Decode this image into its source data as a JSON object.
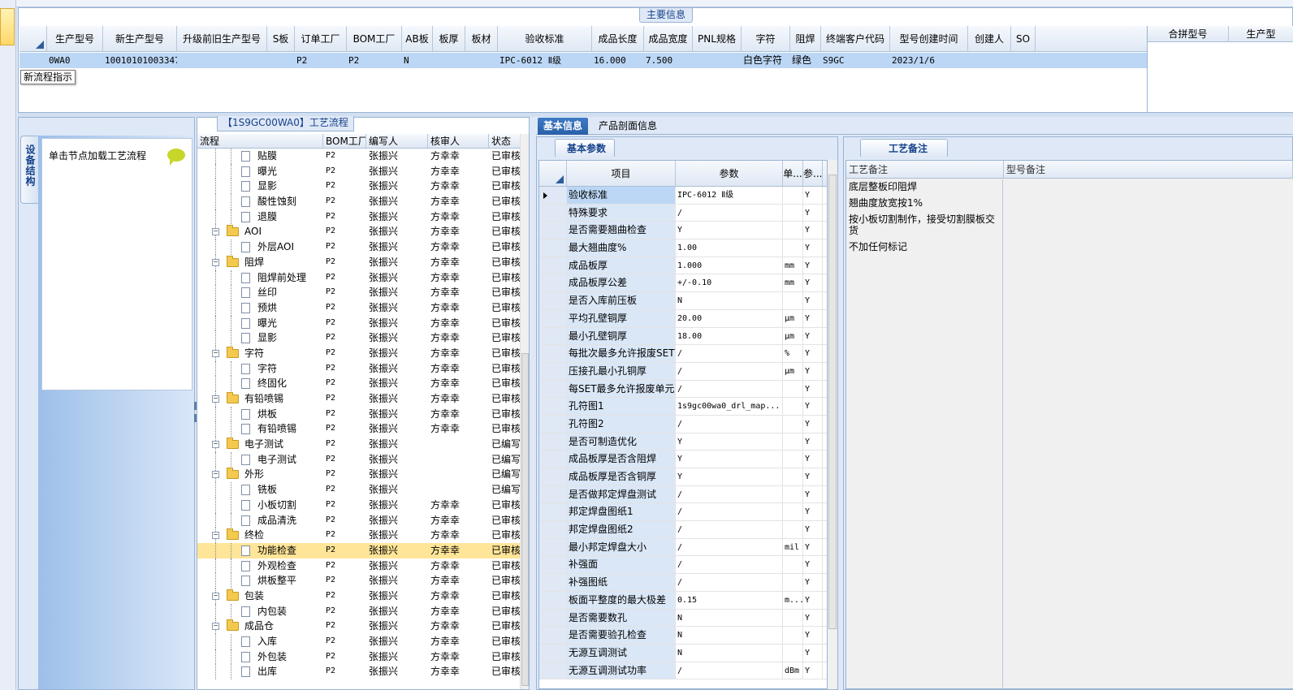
{
  "main_info": {
    "title": "主要信息",
    "columns": [
      "生产型号",
      "新生产型号",
      "升级前旧生产型号",
      "S板",
      "订单工厂",
      "BOM工厂",
      "AB板",
      "板厚",
      "板材",
      "验收标准",
      "成品长度",
      "成品宽度",
      "PNL规格",
      "字符",
      "阻焊",
      "终端客户代码",
      "型号创建时间",
      "创建人",
      "SO"
    ],
    "row": [
      "0WA0",
      "10010101003347",
      "",
      "",
      "P2",
      "P2",
      "N",
      "",
      "",
      "IPC-6012 Ⅱ级",
      "16.000",
      "7.500",
      "",
      "白色字符",
      "绿色",
      "S9GC",
      "2023/1/6",
      "",
      ""
    ],
    "tooltip": "新流程指示",
    "merge_columns": [
      "合拼型号",
      "生产型"
    ]
  },
  "device_panel": {
    "tab_label": "设备结构",
    "item_label": "单击节点加载工艺流程"
  },
  "process_panel": {
    "title": "【1S9GC00WA0】工艺流程",
    "columns": [
      "流程",
      "BOM工厂",
      "编写人",
      "核审人",
      "状态"
    ],
    "rows": [
      {
        "name": "贴膜",
        "level": 2,
        "type": "doc",
        "bom": "P2",
        "writer": "张振兴",
        "reviewer": "方幸幸",
        "status": "已审核"
      },
      {
        "name": "曝光",
        "level": 2,
        "type": "doc",
        "bom": "P2",
        "writer": "张振兴",
        "reviewer": "方幸幸",
        "status": "已审核"
      },
      {
        "name": "显影",
        "level": 2,
        "type": "doc",
        "bom": "P2",
        "writer": "张振兴",
        "reviewer": "方幸幸",
        "status": "已审核"
      },
      {
        "name": "酸性蚀刻",
        "level": 2,
        "type": "doc",
        "bom": "P2",
        "writer": "张振兴",
        "reviewer": "方幸幸",
        "status": "已审核"
      },
      {
        "name": "退膜",
        "level": 2,
        "type": "doc",
        "bom": "P2",
        "writer": "张振兴",
        "reviewer": "方幸幸",
        "status": "已审核"
      },
      {
        "name": "AOI",
        "level": 1,
        "type": "folder",
        "bom": "P2",
        "writer": "张振兴",
        "reviewer": "方幸幸",
        "status": "已审核"
      },
      {
        "name": "外层AOI",
        "level": 2,
        "type": "doc",
        "bom": "P2",
        "writer": "张振兴",
        "reviewer": "方幸幸",
        "status": "已审核"
      },
      {
        "name": "阻焊",
        "level": 1,
        "type": "folder",
        "bom": "P2",
        "writer": "张振兴",
        "reviewer": "方幸幸",
        "status": "已审核"
      },
      {
        "name": "阻焊前处理",
        "level": 2,
        "type": "doc",
        "bom": "P2",
        "writer": "张振兴",
        "reviewer": "方幸幸",
        "status": "已审核"
      },
      {
        "name": "丝印",
        "level": 2,
        "type": "doc",
        "bom": "P2",
        "writer": "张振兴",
        "reviewer": "方幸幸",
        "status": "已审核"
      },
      {
        "name": "预烘",
        "level": 2,
        "type": "doc",
        "bom": "P2",
        "writer": "张振兴",
        "reviewer": "方幸幸",
        "status": "已审核"
      },
      {
        "name": "曝光",
        "level": 2,
        "type": "doc",
        "bom": "P2",
        "writer": "张振兴",
        "reviewer": "方幸幸",
        "status": "已审核"
      },
      {
        "name": "显影",
        "level": 2,
        "type": "doc",
        "bom": "P2",
        "writer": "张振兴",
        "reviewer": "方幸幸",
        "status": "已审核"
      },
      {
        "name": "字符",
        "level": 1,
        "type": "folder",
        "bom": "P2",
        "writer": "张振兴",
        "reviewer": "方幸幸",
        "status": "已审核"
      },
      {
        "name": "字符",
        "level": 2,
        "type": "doc",
        "bom": "P2",
        "writer": "张振兴",
        "reviewer": "方幸幸",
        "status": "已审核"
      },
      {
        "name": "终固化",
        "level": 2,
        "type": "doc",
        "bom": "P2",
        "writer": "张振兴",
        "reviewer": "方幸幸",
        "status": "已审核"
      },
      {
        "name": "有铅喷锡",
        "level": 1,
        "type": "folder",
        "bom": "P2",
        "writer": "张振兴",
        "reviewer": "方幸幸",
        "status": "已审核"
      },
      {
        "name": "烘板",
        "level": 2,
        "type": "doc",
        "bom": "P2",
        "writer": "张振兴",
        "reviewer": "方幸幸",
        "status": "已审核"
      },
      {
        "name": "有铅喷锡",
        "level": 2,
        "type": "doc",
        "bom": "P2",
        "writer": "张振兴",
        "reviewer": "方幸幸",
        "status": "已审核"
      },
      {
        "name": "电子测试",
        "level": 1,
        "type": "folder",
        "bom": "P2",
        "writer": "张振兴",
        "reviewer": "",
        "status": "已编写"
      },
      {
        "name": "电子测试",
        "level": 2,
        "type": "doc",
        "bom": "P2",
        "writer": "张振兴",
        "reviewer": "",
        "status": "已编写"
      },
      {
        "name": "外形",
        "level": 1,
        "type": "folder",
        "bom": "P2",
        "writer": "张振兴",
        "reviewer": "",
        "status": "已编写"
      },
      {
        "name": "铣板",
        "level": 2,
        "type": "doc",
        "bom": "P2",
        "writer": "张振兴",
        "reviewer": "",
        "status": "已编写"
      },
      {
        "name": "小板切割",
        "level": 2,
        "type": "doc",
        "bom": "P2",
        "writer": "张振兴",
        "reviewer": "方幸幸",
        "status": "已审核"
      },
      {
        "name": "成品清洗",
        "level": 2,
        "type": "doc",
        "bom": "P2",
        "writer": "张振兴",
        "reviewer": "方幸幸",
        "status": "已审核"
      },
      {
        "name": "终检",
        "level": 1,
        "type": "folder",
        "bom": "P2",
        "writer": "张振兴",
        "reviewer": "方幸幸",
        "status": "已审核"
      },
      {
        "name": "功能检查",
        "level": 2,
        "type": "doc",
        "bom": "P2",
        "writer": "张振兴",
        "reviewer": "方幸幸",
        "status": "已审核",
        "selected": true
      },
      {
        "name": "外观检查",
        "level": 2,
        "type": "doc",
        "bom": "P2",
        "writer": "张振兴",
        "reviewer": "方幸幸",
        "status": "已审核"
      },
      {
        "name": "烘板整平",
        "level": 2,
        "type": "doc",
        "bom": "P2",
        "writer": "张振兴",
        "reviewer": "方幸幸",
        "status": "已审核"
      },
      {
        "name": "包装",
        "level": 1,
        "type": "folder",
        "bom": "P2",
        "writer": "张振兴",
        "reviewer": "方幸幸",
        "status": "已审核"
      },
      {
        "name": "内包装",
        "level": 2,
        "type": "doc",
        "bom": "P2",
        "writer": "张振兴",
        "reviewer": "方幸幸",
        "status": "已审核"
      },
      {
        "name": "成品仓",
        "level": 1,
        "type": "folder",
        "bom": "P2",
        "writer": "张振兴",
        "reviewer": "方幸幸",
        "status": "已审核"
      },
      {
        "name": "入库",
        "level": 2,
        "type": "doc",
        "bom": "P2",
        "writer": "张振兴",
        "reviewer": "方幸幸",
        "status": "已审核"
      },
      {
        "name": "外包装",
        "level": 2,
        "type": "doc",
        "bom": "P2",
        "writer": "张振兴",
        "reviewer": "方幸幸",
        "status": "已审核"
      },
      {
        "name": "出库",
        "level": 2,
        "type": "doc",
        "bom": "P2",
        "writer": "张振兴",
        "reviewer": "方幸幸",
        "status": "已审核"
      }
    ]
  },
  "tabs": [
    "基本信息",
    "产品剖面信息"
  ],
  "params_panel": {
    "tab_label": "基本参数",
    "columns": [
      "项目",
      "参数",
      "单...",
      "参..."
    ],
    "rows": [
      {
        "item": "验收标准",
        "param": "IPC-6012 Ⅱ级",
        "unit": "",
        "flag": "Y",
        "current": true
      },
      {
        "item": "特殊要求",
        "param": "/",
        "unit": "",
        "flag": "Y"
      },
      {
        "item": "是否需要翘曲检查",
        "param": "Y",
        "unit": "",
        "flag": "Y"
      },
      {
        "item": "最大翘曲度%",
        "param": "1.00",
        "unit": "",
        "flag": "Y"
      },
      {
        "item": "成品板厚",
        "param": "1.000",
        "unit": "mm",
        "flag": "Y"
      },
      {
        "item": "成品板厚公差",
        "param": "+/-0.10",
        "unit": "mm",
        "flag": "Y"
      },
      {
        "item": "是否入库前压板",
        "param": "N",
        "unit": "",
        "flag": "Y"
      },
      {
        "item": "平均孔壁铜厚",
        "param": "20.00",
        "unit": "μm",
        "flag": "Y"
      },
      {
        "item": "最小孔壁铜厚",
        "param": "18.00",
        "unit": "μm",
        "flag": "Y"
      },
      {
        "item": "每批次最多允许报废SET",
        "param": "/",
        "unit": "%",
        "flag": "Y"
      },
      {
        "item": "压接孔最小孔铜厚",
        "param": "/",
        "unit": "μm",
        "flag": "Y"
      },
      {
        "item": "每SET最多允许报废单元",
        "param": "/",
        "unit": "",
        "flag": "Y"
      },
      {
        "item": "孔符图1",
        "param": "1s9gc00wa0_drl_map...",
        "unit": "",
        "flag": "Y"
      },
      {
        "item": "孔符图2",
        "param": "/",
        "unit": "",
        "flag": "Y"
      },
      {
        "item": "是否可制造优化",
        "param": "Y",
        "unit": "",
        "flag": "Y"
      },
      {
        "item": "成品板厚是否含阻焊",
        "param": "Y",
        "unit": "",
        "flag": "Y"
      },
      {
        "item": "成品板厚是否含铜厚",
        "param": "Y",
        "unit": "",
        "flag": "Y"
      },
      {
        "item": "是否做邦定焊盘测试",
        "param": "/",
        "unit": "",
        "flag": "Y"
      },
      {
        "item": "邦定焊盘图纸1",
        "param": "/",
        "unit": "",
        "flag": "Y"
      },
      {
        "item": "邦定焊盘图纸2",
        "param": "/",
        "unit": "",
        "flag": "Y"
      },
      {
        "item": "最小邦定焊盘大小",
        "param": "/",
        "unit": "mil",
        "flag": "Y"
      },
      {
        "item": "补强面",
        "param": "/",
        "unit": "",
        "flag": "Y"
      },
      {
        "item": "补强图纸",
        "param": "/",
        "unit": "",
        "flag": "Y"
      },
      {
        "item": "板面平整度的最大极差",
        "param": "0.15",
        "unit": "m...",
        "flag": "Y"
      },
      {
        "item": "是否需要数孔",
        "param": "N",
        "unit": "",
        "flag": "Y"
      },
      {
        "item": "是否需要验孔检查",
        "param": "N",
        "unit": "",
        "flag": "Y"
      },
      {
        "item": "无源互调测试",
        "param": "N",
        "unit": "",
        "flag": "Y"
      },
      {
        "item": "无源互调测试功率",
        "param": "/",
        "unit": "dBm",
        "flag": "Y"
      }
    ]
  },
  "notes_panel": {
    "tab_label": "工艺备注",
    "columns": [
      "工艺备注",
      "型号备注"
    ],
    "process_notes": [
      "底层整板印阻焊",
      "翘曲度放宽按1%",
      "按小板切割制作，接受切割膜板交货",
      "不加任何标记"
    ]
  }
}
